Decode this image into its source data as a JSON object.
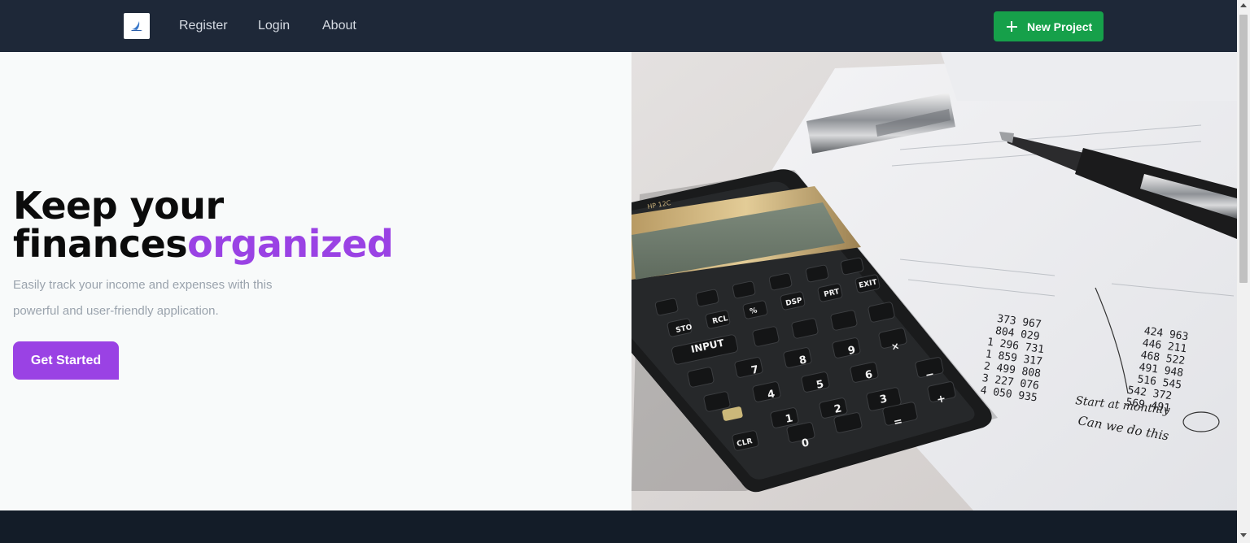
{
  "navbar": {
    "logo_icon": "app-logo-icon",
    "links": [
      {
        "label": "Register"
      },
      {
        "label": "Login"
      },
      {
        "label": "About"
      }
    ],
    "new_project_label": "New Project",
    "new_project_icon": "plus-icon",
    "new_project_color": "#16a04a"
  },
  "hero": {
    "title_line1": "Keep your",
    "title_line2_plain": "finances",
    "title_line2_accent": "organized",
    "accent_color": "#9a42e4",
    "description": "Easily track your income and expenses with this powerful and user-friendly application.",
    "cta_label": "Get Started",
    "image_subject": "calculator-pen-finance-papers"
  },
  "calculator": {
    "input_key": "INPUT",
    "printed_lines_mid": [
      "373 967",
      "804 029",
      "1 296 731",
      "1 859 317",
      "2 499 808",
      "3 227 076",
      "4 050 935"
    ],
    "printed_lines_right": [
      "424 963",
      "446 211",
      "468 522",
      "491 948",
      "516 545",
      "542 372",
      "569 491"
    ],
    "handwriting_1": "Start at monthly",
    "handwriting_2": "Can we do this"
  }
}
